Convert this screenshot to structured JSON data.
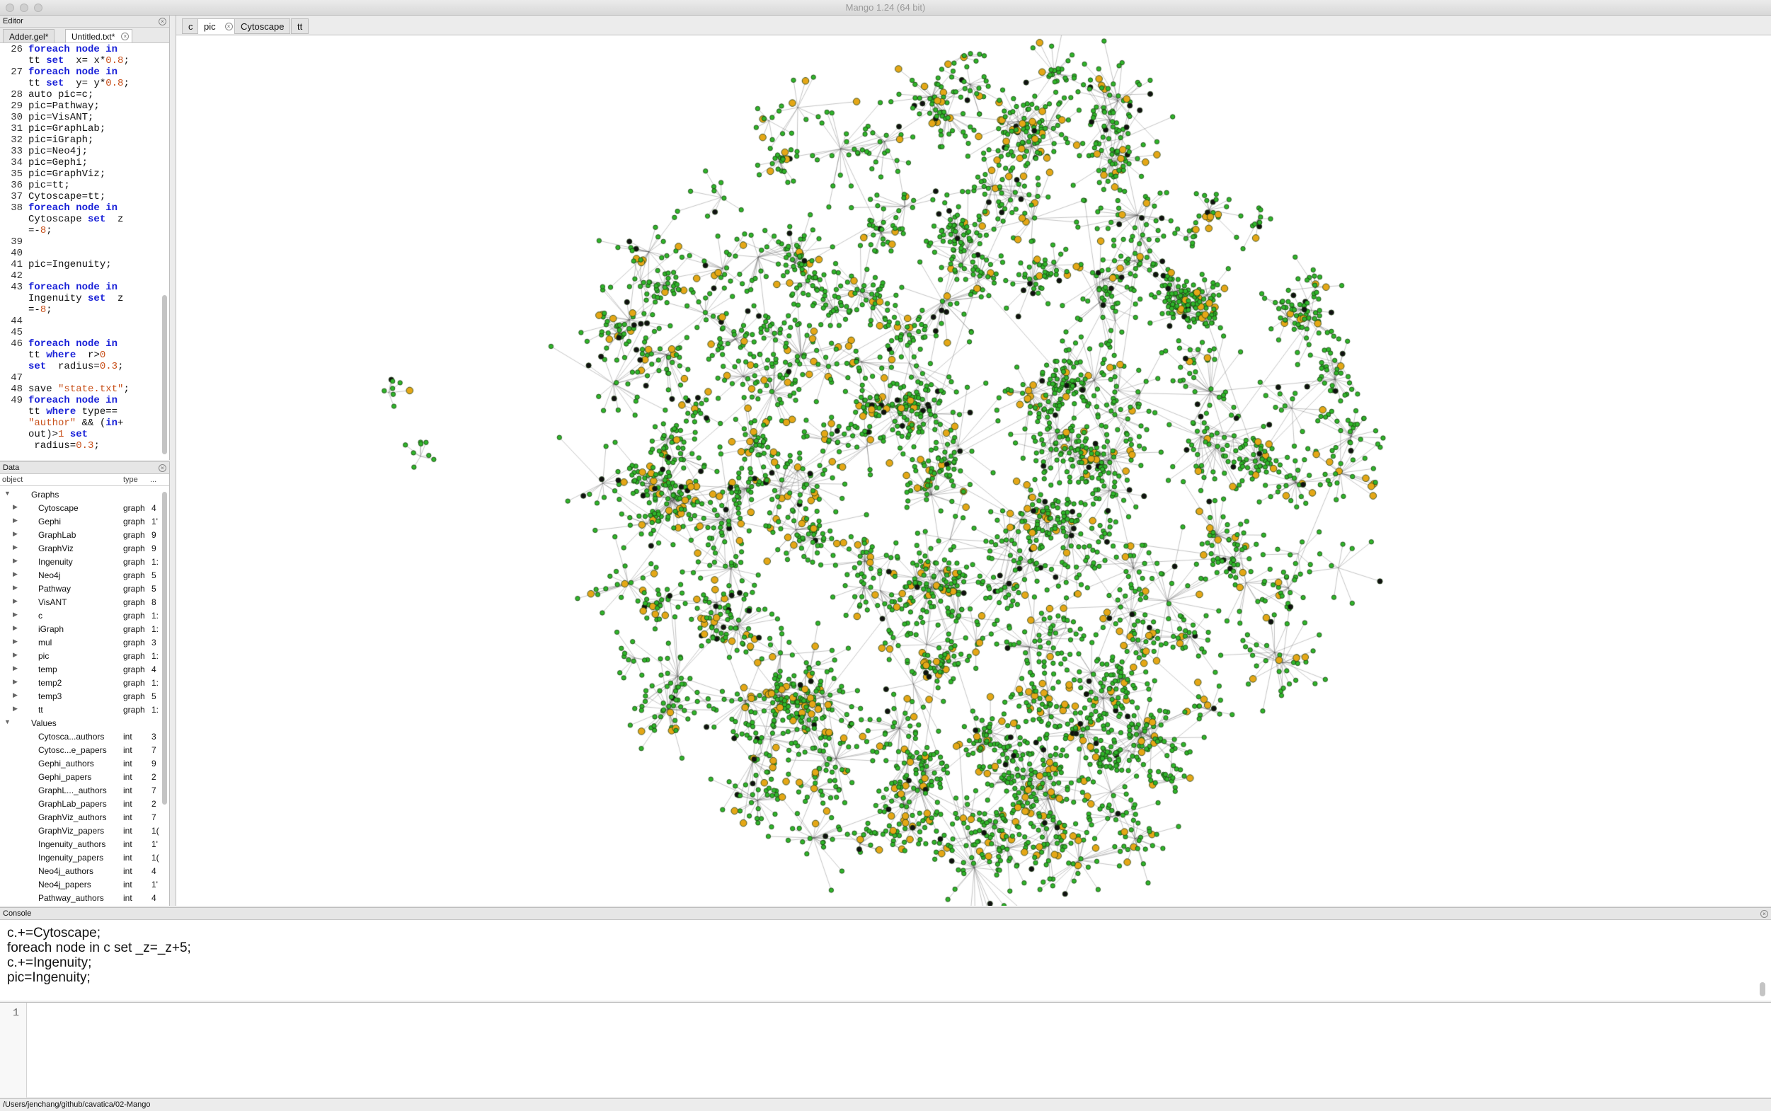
{
  "window": {
    "title": "Mango 1.24 (64 bit)"
  },
  "editor": {
    "header": "Editor",
    "tabs": [
      {
        "label": "Adder.gel*"
      },
      {
        "label": "Untitled.txt*"
      }
    ],
    "lines": [
      {
        "n": "26",
        "t": "foreach node in"
      },
      {
        "n": "",
        "t": "tt set  x= x*0.8;"
      },
      {
        "n": "27",
        "t": "foreach node in"
      },
      {
        "n": "",
        "t": "tt set  y= y*0.8;"
      },
      {
        "n": "28",
        "t": "auto pic=c;"
      },
      {
        "n": "29",
        "t": "pic=Pathway;"
      },
      {
        "n": "30",
        "t": "pic=VisANT;"
      },
      {
        "n": "31",
        "t": "pic=GraphLab;"
      },
      {
        "n": "32",
        "t": "pic=iGraph;"
      },
      {
        "n": "33",
        "t": "pic=Neo4j;"
      },
      {
        "n": "34",
        "t": "pic=Gephi;"
      },
      {
        "n": "35",
        "t": "pic=GraphViz;"
      },
      {
        "n": "36",
        "t": "pic=tt;"
      },
      {
        "n": "37",
        "t": "Cytoscape=tt;"
      },
      {
        "n": "38",
        "t": "foreach node in"
      },
      {
        "n": "",
        "t": "Cytoscape set  z"
      },
      {
        "n": "",
        "t": "=-8;"
      },
      {
        "n": "",
        "t": ""
      },
      {
        "n": "39",
        "t": ""
      },
      {
        "n": "40",
        "t": ""
      },
      {
        "n": "41",
        "t": "pic=Ingenuity;"
      },
      {
        "n": "42",
        "t": ""
      },
      {
        "n": "43",
        "t": "foreach node in"
      },
      {
        "n": "",
        "t": "Ingenuity set  z"
      },
      {
        "n": "",
        "t": "=-8;"
      },
      {
        "n": "44",
        "t": ""
      },
      {
        "n": "45",
        "t": ""
      },
      {
        "n": "46",
        "t": "foreach node in"
      },
      {
        "n": "",
        "t": "tt where  r>0"
      },
      {
        "n": "",
        "t": "set  radius=0.3;"
      },
      {
        "n": "47",
        "t": ""
      },
      {
        "n": "48",
        "t": "save \"state.txt\";"
      },
      {
        "n": "49",
        "t": "foreach node in"
      },
      {
        "n": "",
        "t": "tt where type=="
      },
      {
        "n": "",
        "t": "\"author\" && (in+"
      },
      {
        "n": "",
        "t": "out)>1 set"
      },
      {
        "n": "",
        "t": " radius=0.3;"
      }
    ]
  },
  "data_panel": {
    "header": "Data",
    "columns": {
      "object": "object",
      "type": "type",
      "size": "..."
    },
    "graphs_label": "Graphs",
    "graphs": [
      {
        "name": "Cytoscape",
        "type": "graph",
        "size": "4"
      },
      {
        "name": "Gephi",
        "type": "graph",
        "size": "1'"
      },
      {
        "name": "GraphLab",
        "type": "graph",
        "size": "9"
      },
      {
        "name": "GraphViz",
        "type": "graph",
        "size": "9"
      },
      {
        "name": "Ingenuity",
        "type": "graph",
        "size": "1:"
      },
      {
        "name": "Neo4j",
        "type": "graph",
        "size": "5"
      },
      {
        "name": "Pathway",
        "type": "graph",
        "size": "5"
      },
      {
        "name": "VisANT",
        "type": "graph",
        "size": "8"
      },
      {
        "name": "c",
        "type": "graph",
        "size": "1:"
      },
      {
        "name": "iGraph",
        "type": "graph",
        "size": "1:"
      },
      {
        "name": "mul",
        "type": "graph",
        "size": "3"
      },
      {
        "name": "pic",
        "type": "graph",
        "size": "1:"
      },
      {
        "name": "temp",
        "type": "graph",
        "size": "4"
      },
      {
        "name": "temp2",
        "type": "graph",
        "size": "1:"
      },
      {
        "name": "temp3",
        "type": "graph",
        "size": "5"
      },
      {
        "name": "tt",
        "type": "graph",
        "size": "1:"
      }
    ],
    "values_label": "Values",
    "values": [
      {
        "name": "Cytosca...authors",
        "type": "int",
        "size": "3"
      },
      {
        "name": "Cytosc...e_papers",
        "type": "int",
        "size": "7"
      },
      {
        "name": "Gephi_authors",
        "type": "int",
        "size": "9"
      },
      {
        "name": "Gephi_papers",
        "type": "int",
        "size": "2"
      },
      {
        "name": "GraphL..._authors",
        "type": "int",
        "size": "7"
      },
      {
        "name": "GraphLab_papers",
        "type": "int",
        "size": "2"
      },
      {
        "name": "GraphViz_authors",
        "type": "int",
        "size": "7"
      },
      {
        "name": "GraphViz_papers",
        "type": "int",
        "size": "1("
      },
      {
        "name": "Ingenuity_authors",
        "type": "int",
        "size": "1'"
      },
      {
        "name": "Ingenuity_papers",
        "type": "int",
        "size": "1("
      },
      {
        "name": "Neo4j_authors",
        "type": "int",
        "size": "4"
      },
      {
        "name": "Neo4j_papers",
        "type": "int",
        "size": "1'"
      },
      {
        "name": "Pathway_authors",
        "type": "int",
        "size": "4"
      }
    ]
  },
  "view": {
    "tabs": [
      {
        "label": "c"
      },
      {
        "label": "pic"
      },
      {
        "label": "Cytoscape"
      },
      {
        "label": "tt"
      }
    ],
    "colors": {
      "author_node": "#2fb52a",
      "paper_node": "#e5a716",
      "hub_node": "#111111",
      "edge": "#555555"
    }
  },
  "console": {
    "header": "Console",
    "lines": [
      "c.+=Cytoscape;",
      "foreach node in c set _z=_z+5;",
      "c.+=Ingenuity;",
      "pic=Ingenuity;"
    ]
  },
  "input": {
    "line_number": "1"
  },
  "status": {
    "path": "/Users/jenchang/github/cavatica/02-Mango"
  }
}
